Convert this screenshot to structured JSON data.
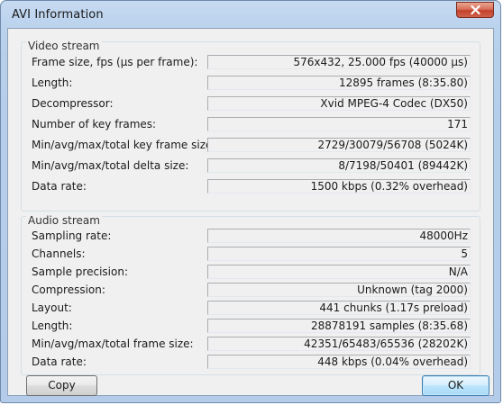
{
  "window": {
    "title": "AVI Information"
  },
  "video": {
    "title": "Video stream",
    "rows": [
      {
        "label": "Frame size, fps (µs per frame):",
        "value": "576x432, 25.000 fps (40000 µs)"
      },
      {
        "label": "Length:",
        "value": "12895 frames (8:35.80)"
      },
      {
        "label": "Decompressor:",
        "value": "Xvid MPEG-4 Codec (DX50)"
      },
      {
        "label": "Number of key frames:",
        "value": "171"
      },
      {
        "label": "Min/avg/max/total key frame size:",
        "value": "2729/30079/56708 (5024K)"
      },
      {
        "label": "Min/avg/max/total delta size:",
        "value": "8/7198/50401 (89442K)"
      },
      {
        "label": "Data rate:",
        "value": "1500 kbps (0.32% overhead)"
      }
    ]
  },
  "audio": {
    "title": "Audio stream",
    "rows": [
      {
        "label": "Sampling rate:",
        "value": "48000Hz"
      },
      {
        "label": "Channels:",
        "value": "5"
      },
      {
        "label": "Sample precision:",
        "value": "N/A"
      },
      {
        "label": "Compression:",
        "value": "Unknown (tag 2000)"
      },
      {
        "label": "Layout:",
        "value": "441 chunks (1.17s preload)"
      },
      {
        "label": "Length:",
        "value": "28878191 samples (8:35.68)"
      },
      {
        "label": "Min/avg/max/total frame size:",
        "value": "42351/65483/65536 (28202K)"
      },
      {
        "label": "Data rate:",
        "value": "448 kbps (0.04% overhead)"
      }
    ]
  },
  "buttons": {
    "copy": "Copy",
    "ok": "OK"
  }
}
